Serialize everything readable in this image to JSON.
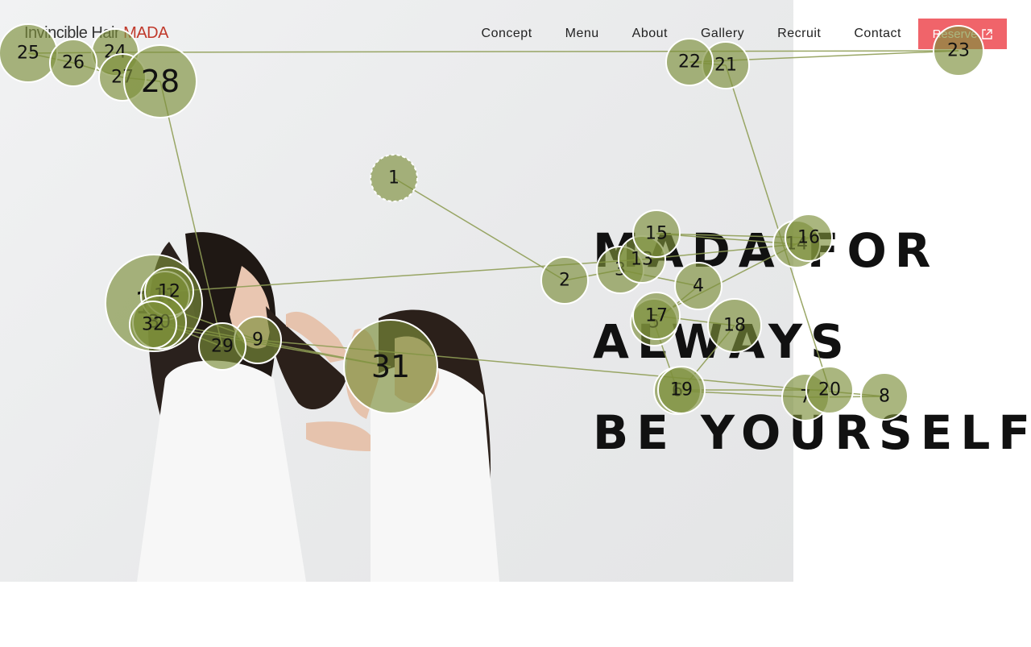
{
  "header": {
    "logo_text": "Invincible Hair",
    "logo_accent": "MADA",
    "nav": [
      "Concept",
      "Menu",
      "About",
      "Gallery",
      "Recruit",
      "Contact"
    ],
    "reserve_label": "Reserve"
  },
  "hero": {
    "headline_lines": [
      "MADA FOR",
      "ALWAYS",
      "BE YOURSELF."
    ]
  },
  "colors": {
    "accent": "#f0646a",
    "logo_accent": "#c0392b",
    "gaze_fill": "#7d8f3a"
  },
  "gaze_labels": [
    "1",
    "2",
    "3",
    "4",
    "5",
    "6",
    "7",
    "8",
    "9",
    "10",
    "11",
    "12",
    "13",
    "14",
    "15",
    "16",
    "17",
    "18",
    "19",
    "20",
    "21",
    "22",
    "23",
    "24",
    "25",
    "26",
    "27",
    "28",
    "29",
    "30",
    "31",
    "32"
  ]
}
